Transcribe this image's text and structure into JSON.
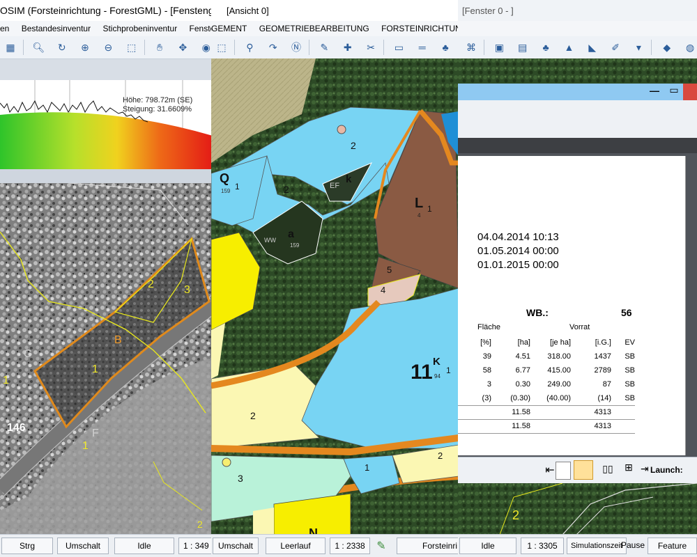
{
  "win1": {
    "title": "OSIM (Forsteinrichtung - ForestGML) - [Fensteng",
    "menu": [
      "en",
      "Bestandesinventur",
      "Stichprobeninventur",
      "Fenster"
    ],
    "profile": {
      "hoehe": "Höhe: 798.72m (SE)",
      "steigung": "Steigung: 31.6609%"
    },
    "map_labels": {
      "l2": "2",
      "l3": "3",
      "lB": "B",
      "l1a": "1",
      "lC": "C",
      "l1b": "1",
      "l146": "146",
      "l1c": "1",
      "lF": "F",
      "l2b": "2"
    },
    "status": {
      "strg": "Strg",
      "umschalt": "Umschalt",
      "idle": "Idle",
      "scale": "1 : 349"
    }
  },
  "win2": {
    "title": "[Ansicht 0]",
    "menu": [
      "GEMENT",
      "GEOMETRIEBEARBEITUNG",
      "FORSTEINRICHTUNG",
      "F"
    ],
    "map_labels": {
      "n2a": "2",
      "Q": "Q",
      "Qsub": "159",
      "Q1": "1",
      "n2b": "2",
      "EF": "EF",
      "k": "k",
      "L": "L",
      "Lsub": "4",
      "L1": "1",
      "a": "a",
      "asub": "159",
      "WW": "WW",
      "n5": "5",
      "n4": "4",
      "big11": "11",
      "bigK": "K",
      "bigSub": "94",
      "big1": "1",
      "n2c": "2",
      "n3": "3",
      "n1": "1",
      "n2d": "2",
      "N": "N"
    },
    "status": {
      "umschalt": "Umschalt",
      "leerlauf": "Leerlauf",
      "scale": "1 : 2338",
      "forst": "Forsteinri"
    }
  },
  "win3": {
    "title": "[Fenster 0 - ]",
    "dates": [
      "04.04.2014 10:13",
      "01.05.2014 00:00",
      "01.01.2015 00:00"
    ],
    "wb_label": "WB.:",
    "wb_value": "56",
    "header1": {
      "flaeche": "Fläche",
      "vorrat": "Vorrat"
    },
    "header2": [
      "[%]",
      "[ha]",
      "[je ha]",
      "[i.G.]",
      "EV"
    ],
    "rows": [
      [
        "39",
        "4.51",
        "318.00",
        "1437",
        "SB"
      ],
      [
        "58",
        "6.77",
        "415.00",
        "2789",
        "SB"
      ],
      [
        "3",
        "0.30",
        "249.00",
        "87",
        "SB"
      ],
      [
        "(3)",
        "(0.30)",
        "(40.00)",
        "(14)",
        "SB"
      ]
    ],
    "totals": [
      [
        "11.58",
        "4313"
      ],
      [
        "11.58",
        "4313"
      ]
    ],
    "launch": "Launch:",
    "map_label": "2",
    "status": {
      "idle": "Idle",
      "scale": "1 : 3305",
      "sim": "Simulationszeit",
      "pause": "Pause",
      "feature": "Feature"
    }
  }
}
